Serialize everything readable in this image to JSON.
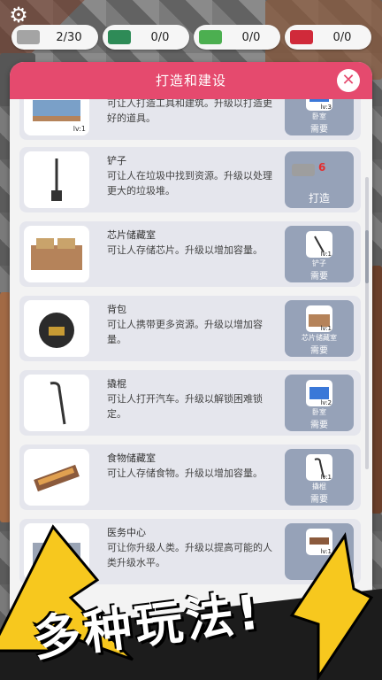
{
  "hud": {
    "settings_icon": "gear-icon",
    "resources": [
      {
        "icon": "scrap-metal-icon",
        "value": "2/30",
        "color": "#a4a4a4"
      },
      {
        "icon": "chip-icon",
        "value": "0/0",
        "color": "#2e8b57"
      },
      {
        "icon": "parts-icon",
        "value": "0/0",
        "color": "#4caf50"
      },
      {
        "icon": "meat-icon",
        "value": "0/0",
        "color": "#d02a3a"
      }
    ]
  },
  "panel": {
    "title": "打造和建设",
    "close_icon": "close-icon"
  },
  "items": [
    {
      "name": "",
      "desc": "可让人打造工具和建筑。升级以打造更好的道具。",
      "level": "lv:1",
      "req": {
        "level": "lv:3",
        "name": "卧室",
        "need": "需要"
      }
    },
    {
      "name": "铲子",
      "desc": "可让人在垃圾中找到资源。升级以处理更大的垃圾堆。",
      "level": "",
      "craft": {
        "cost": "6",
        "label": "打造"
      }
    },
    {
      "name": "芯片储藏室",
      "desc": "可让人存储芯片。升级以增加容量。",
      "level": "",
      "req": {
        "level": "lv:1",
        "name": "铲子",
        "need": "需要"
      }
    },
    {
      "name": "背包",
      "desc": "可让人携带更多资源。升级以增加容量。",
      "level": "",
      "req": {
        "level": "lv:1",
        "name": "芯片储藏室",
        "need": "需要"
      }
    },
    {
      "name": "撬棍",
      "desc": "可让人打开汽车。升级以解锁困难锁定。",
      "level": "",
      "req": {
        "level": "lv:2",
        "name": "卧室",
        "need": "需要"
      }
    },
    {
      "name": "食物储藏室",
      "desc": "可让人存储食物。升级以增加容量。",
      "level": "",
      "req": {
        "level": "lv:1",
        "name": "撬棍",
        "need": "需要"
      }
    },
    {
      "name": "医务中心",
      "desc": "可让你升级人类。升级以提高可能的人类升级水平。",
      "level": "",
      "req": {
        "level": "lv:1",
        "name": "",
        "need": ""
      }
    }
  ],
  "banner": {
    "text": "多种玩法!"
  }
}
